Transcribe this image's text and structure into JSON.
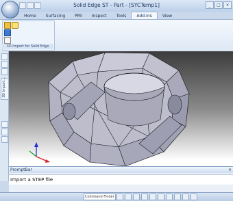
{
  "window": {
    "title": "Solid Edge ST - Part - [SYCTemp1]",
    "controls": [
      "_",
      "□",
      "×"
    ]
  },
  "quick_access": {
    "icons": [
      "save-icon",
      "undo-icon",
      "redo-icon",
      "dropdown-icon"
    ]
  },
  "ribbon": {
    "tabs": [
      "Home",
      "Surfacing",
      "PMI",
      "Inspect",
      "Tools",
      "Add-Ins",
      "View"
    ],
    "active_tab": "Add-Ins",
    "group_label": "3D Import for Solid Edge"
  },
  "left_toolbar": {
    "vertical_tab": "3D Import..."
  },
  "prompt_bar": {
    "title": "PromptBar",
    "text": "Import a STEP file",
    "close": "×"
  },
  "status_bar": {
    "command_finder_placeholder": "Command Finder"
  },
  "colors": {
    "ribbon_bg": "#dde8f5",
    "viewport_top": "#3c3c3c",
    "viewport_bottom": "#ffffff",
    "model_fill": "#b9b9c8",
    "axis_x": "#d42020",
    "axis_y": "#1fa21f",
    "axis_z": "#2030d0"
  }
}
